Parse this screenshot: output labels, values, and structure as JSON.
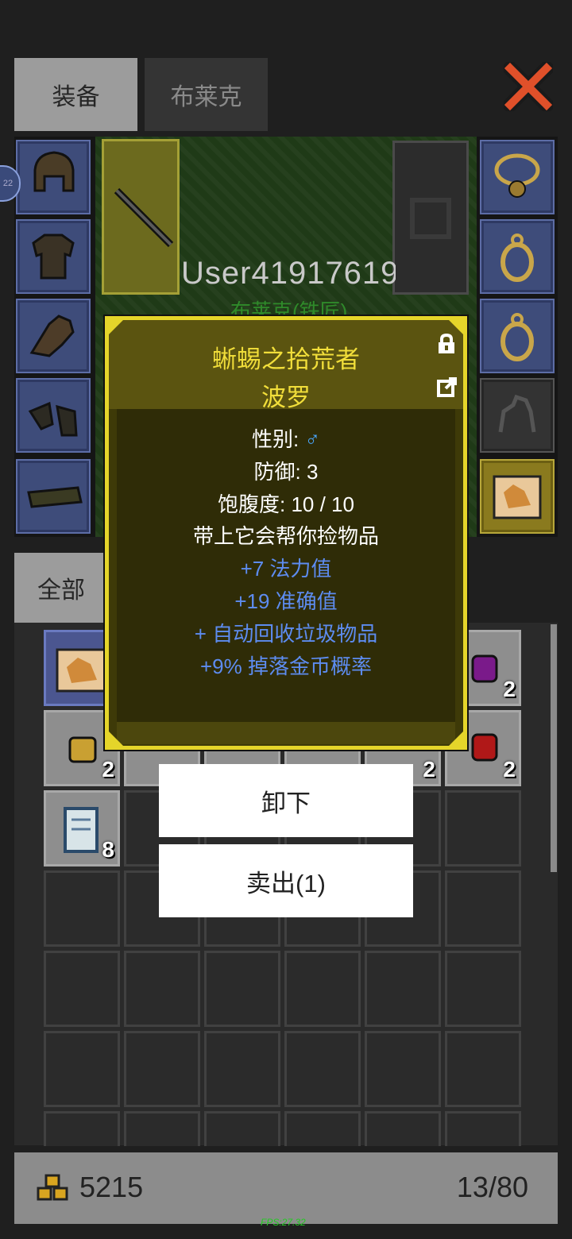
{
  "tabs": {
    "equipment": "装备",
    "character": "布莱克"
  },
  "character": {
    "username": "User41917619",
    "subtitle": "布莱克(铁匠)",
    "level_badge": "22"
  },
  "inventory": {
    "filter_tab": "全部",
    "counts": {
      "r1c6": "2",
      "r2c1": "2",
      "r2c5": "2",
      "r2c6": "2",
      "r3c1": "8"
    }
  },
  "bottom": {
    "gold": "5215",
    "capacity": "13/80",
    "fps": "FPS:27.32"
  },
  "popup": {
    "title": "蜥蜴之拾荒者",
    "name": "波罗",
    "gender_label": "性别: ",
    "gender_symbol": "♂",
    "defense": "防御: 3",
    "satiety": "饱腹度: 10 / 10",
    "desc": "带上它会帮你捡物品",
    "stat1": "+7 法力值",
    "stat2": "+19 准确值",
    "stat3": "+ 自动回收垃圾物品",
    "stat4": "+9% 掉落金币概率"
  },
  "actions": {
    "unequip": "卸下",
    "sell": "卖出(1)"
  },
  "colors": {
    "accent_yellow": "#e5d52a",
    "stat_blue": "#5d8cf0",
    "gender_blue": "#4aa8ff"
  },
  "icons": [
    "close-icon",
    "lock-icon",
    "export-icon",
    "gold-coins-icon"
  ]
}
